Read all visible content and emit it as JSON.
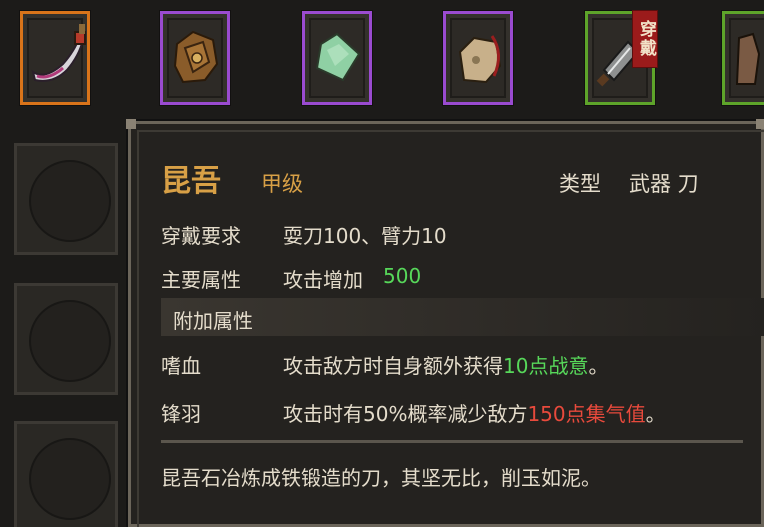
{
  "equipment_bar": {
    "slots": [
      {
        "icon": "curved-blade-icon",
        "rarity_color": "#d9741a"
      },
      {
        "icon": "leather-armor-icon",
        "rarity_color": "#9a4bd0"
      },
      {
        "icon": "jade-stone-icon",
        "rarity_color": "#9a4bd0"
      },
      {
        "icon": "pouch-icon",
        "rarity_color": "#9a4bd0"
      },
      {
        "icon": "cleaver-icon",
        "rarity_color": "#5ea42a",
        "badge": "穿戴"
      },
      {
        "icon": "robe-icon",
        "rarity_color": "#5ea42a"
      }
    ]
  },
  "tooltip": {
    "name": "昆吾",
    "grade": "甲级",
    "type_label": "类型",
    "type_value": "武器 刀",
    "requirement_label": "穿戴要求",
    "requirement_value": "耍刀100、臂力10",
    "main_attr_label": "主要属性",
    "main_attr_text": "攻击增加",
    "main_attr_value": "500",
    "extra_attr_header": "附加属性",
    "extra_attrs": [
      {
        "name": "嗜血",
        "text": "攻击敌方时自身额外获得",
        "highlight": "10点战意",
        "suffix": "。",
        "highlight_color": "#57d85a"
      },
      {
        "name": "锋羽",
        "text": "攻击时有50%概率减少敌方",
        "highlight": "150点集气值",
        "suffix": "。",
        "highlight_color": "#e84a3c"
      }
    ],
    "description": "昆吾石冶炼成铁锻造的刀，其坚无比，削玉如泥。"
  }
}
